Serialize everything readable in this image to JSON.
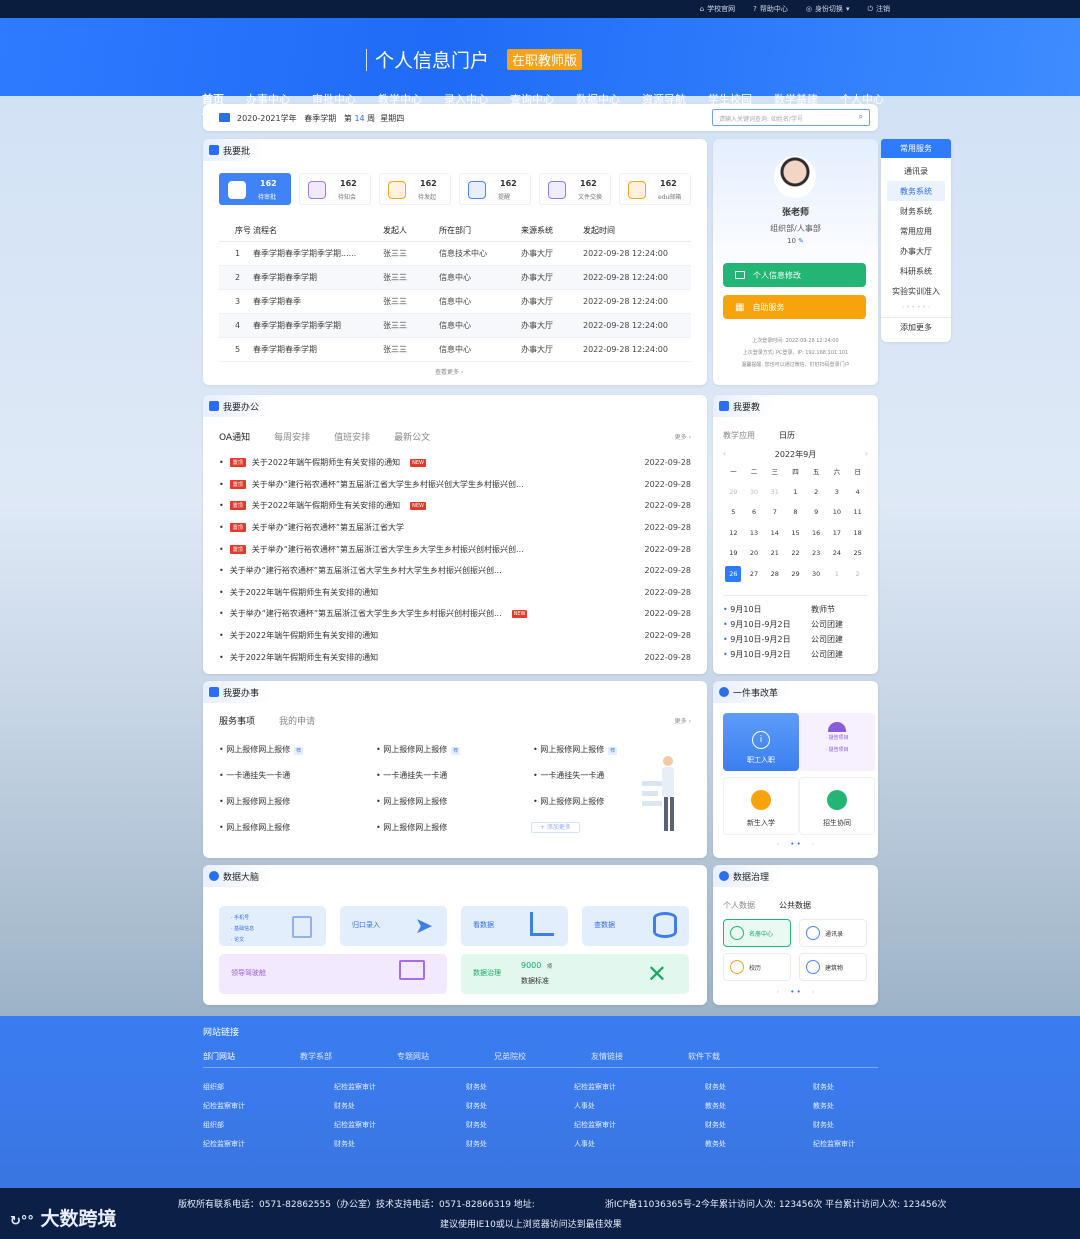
{
  "topbar": {
    "links": [
      "学校官网",
      "帮助中心",
      "身份切换",
      "注销"
    ]
  },
  "header": {
    "title": "个人信息门户",
    "edition": "在职教师版"
  },
  "nav": [
    "首页",
    "办事中心",
    "审批中心",
    "教学中心",
    "录入中心",
    "查询中心",
    "数据中心",
    "资源导航",
    "学生校园",
    "数学基建",
    "个人中心"
  ],
  "datebar": {
    "year": "2020-2021学年",
    "term": "春季学期",
    "week_pre": "第",
    "week": "14",
    "week_post": "周",
    "day": "星期四",
    "search_placeholder": "请输入关键词查询: 如姓名/学号"
  },
  "approve": {
    "title": "我要批",
    "stats": [
      {
        "n": "162",
        "l": "待审批",
        "color": "#ffffff"
      },
      {
        "n": "162",
        "l": "待知会",
        "color": "#f2e9ff"
      },
      {
        "n": "162",
        "l": "待发起",
        "color": "#fff3dd"
      },
      {
        "n": "162",
        "l": "提醒",
        "color": "#e8f0ff"
      },
      {
        "n": "162",
        "l": "文件交换",
        "color": "#f1ecff"
      },
      {
        "n": "162",
        "l": "edu邮箱",
        "color": "#fff1db"
      }
    ],
    "headers": [
      "序号",
      "流程名",
      "发起人",
      "所在部门",
      "来源系统",
      "发起时间"
    ],
    "rows": [
      [
        "1",
        "春季学期春季学期季学期......",
        "张三三",
        "信息技术中心",
        "办事大厅",
        "2022-09-28  12:24:00"
      ],
      [
        "2",
        "春季学期春季学期",
        "张三三",
        "信息中心",
        "办事大厅",
        "2022-09-28  12:24:00"
      ],
      [
        "3",
        "春季学期春季",
        "张三三",
        "信息中心",
        "办事大厅",
        "2022-09-28  12:24:00"
      ],
      [
        "4",
        "春季学期春季学期季学期",
        "张三三",
        "信息中心",
        "办事大厅",
        "2022-09-28  12:24:00"
      ],
      [
        "5",
        "春季学期春季学期",
        "张三三",
        "信息中心",
        "办事大厅",
        "2022-09-28  12:24:00"
      ]
    ],
    "more": "查看更多"
  },
  "profile": {
    "name": "张老师",
    "dept": "组织部/人事部",
    "score": "10",
    "btn_edit": "个人信息修改",
    "btn_self": "自助服务",
    "last_login": "上次登录时间: 2022-09-28  12:24:00",
    "login_way": "上次登录方式: PC登录，IP: 192.168.101.101",
    "tip": "温馨提醒: 您也可以通过微信、钉钉扫码登录门户"
  },
  "quick": {
    "title": "常用服务",
    "items": [
      "通讯录",
      "教务系统",
      "财务系统",
      "常用应用",
      "办事大厅",
      "科研系统",
      "实验实训准入"
    ],
    "add": "添加更多"
  },
  "office": {
    "title": "我要办公",
    "tabs": [
      "OA通知",
      "每周安排",
      "值班安排",
      "最新公文"
    ],
    "more": "更多",
    "top_tag": "置顶",
    "new_tag": "NEW",
    "items": [
      {
        "t": "关于2022年端午假期师生有关安排的通知",
        "d": "2022-09-28",
        "top": true,
        "new": true
      },
      {
        "t": "关于举办“建行裕农通杯”第五届浙江省大学生乡村振兴创大学生乡村振兴创...",
        "d": "2022-09-28",
        "top": true,
        "new": false
      },
      {
        "t": "关于2022年端午假期师生有关安排的通知",
        "d": "2022-09-28",
        "top": true,
        "new": true
      },
      {
        "t": "关于举办“建行裕农通杯”第五届浙江省大学",
        "d": "2022-09-28",
        "top": true,
        "new": false
      },
      {
        "t": "关于举办“建行裕农通杯”第五届浙江省大学生乡大学生乡村振兴创村振兴创...",
        "d": "2022-09-28",
        "top": true,
        "new": false
      },
      {
        "t": "关于举办“建行裕农通杯”第五届浙江省大学生乡村大学生乡村振兴创振兴创...",
        "d": "2022-09-28",
        "top": false,
        "new": false
      },
      {
        "t": "关于2022年端午假期师生有关安排的通知",
        "d": "2022-09-28",
        "top": false,
        "new": false
      },
      {
        "t": "关于举办“建行裕农通杯”第五届浙江省大学生乡大学生乡村振兴创村振兴创...",
        "d": "2022-09-28",
        "top": false,
        "new": true
      },
      {
        "t": "关于2022年端午假期师生有关安排的通知",
        "d": "2022-09-28",
        "top": false,
        "new": false
      },
      {
        "t": "关于2022年端午假期师生有关安排的通知",
        "d": "2022-09-28",
        "top": false,
        "new": false
      }
    ]
  },
  "teach": {
    "title": "我要教",
    "tabs": [
      "教学应用",
      "日历"
    ],
    "month": "2022年9月",
    "weekdays": [
      "一",
      "二",
      "三",
      "四",
      "五",
      "六",
      "日"
    ],
    "weeks": [
      [
        "29",
        "30",
        "31",
        "1",
        "2",
        "3",
        "4"
      ],
      [
        "5",
        "6",
        "7",
        "8",
        "9",
        "10",
        "11"
      ],
      [
        "12",
        "13",
        "14",
        "15",
        "16",
        "17",
        "18"
      ],
      [
        "19",
        "20",
        "21",
        "22",
        "23",
        "24",
        "25"
      ],
      [
        "26",
        "27",
        "28",
        "29",
        "30",
        "1",
        "2"
      ]
    ],
    "events": [
      [
        "9月10日",
        "教师节"
      ],
      [
        "9月10日-9月2日",
        "公司团建"
      ],
      [
        "9月10日-9月2日",
        "公司团建"
      ],
      [
        "9月10日-9月2日",
        "公司团建"
      ]
    ]
  },
  "svc": {
    "title": "我要办事",
    "tabs": [
      "服务事项",
      "我的申请"
    ],
    "more": "更多",
    "rows": [
      [
        "网上报修网上报修",
        "网上报修网上报修",
        "网上报修网上报修"
      ],
      [
        "一卡通挂失一卡通",
        "一卡通挂失一卡通",
        "一卡通挂失一卡通"
      ],
      [
        "网上报修网上报修",
        "网上报修网上报修",
        "网上报修网上报修"
      ],
      [
        "网上报修网上报修",
        "网上报修网上报修",
        ""
      ]
    ],
    "tag": "荐",
    "add": "+ 添加更多"
  },
  "reform": {
    "title": "一件事改革",
    "tiles": [
      "职工入职",
      "新生入学",
      "招生协同"
    ],
    "t2a": "· 疑告项目",
    "t2b": "· 疑告项目"
  },
  "brain": {
    "title": "数据大脑",
    "b1": [
      "· 手机号",
      "· 基础信息",
      "· 论文"
    ],
    "b2": "归口录入",
    "b3": "看数据",
    "b4": "查数据",
    "b5": "领导驾驶舱",
    "b6": "数据治理",
    "b6n": "9000",
    "b6u": "项",
    "b6s": "数据标准"
  },
  "gov": {
    "title": "数据治理",
    "tabs": [
      "个人数据",
      "公共数据"
    ],
    "items": [
      "名册中心",
      "通讯录",
      "校历",
      "建筑物"
    ]
  },
  "footer": {
    "title": "网站链接",
    "tabs": [
      "部门网站",
      "教学系部",
      "专题网站",
      "兄弟院校",
      "友情链接",
      "软件下载"
    ],
    "cols": [
      [
        "组织部",
        "纪检监察审计",
        "组织部",
        "纪检监察审计"
      ],
      [
        "纪检监察审计",
        "财务处",
        "纪检监察审计",
        "财务处"
      ],
      [
        "财务处",
        "财务处",
        "财务处",
        "财务处"
      ],
      [
        "纪检监察审计",
        "人事处",
        "纪检监察审计",
        "人事处"
      ],
      [
        "财务处",
        "教务处",
        "财务处",
        "教务处"
      ],
      [
        "财务处",
        "教务处",
        "财务处",
        "纪检监察审计"
      ]
    ]
  },
  "bottom": {
    "l1": "版权所有联系电话：0571-82862555（办公室）技术支持电话：0571-82866319 地址:",
    "l1b": "浙ICP备11036365号-2今年累计访问人次: 123456次  平台累计访问人次: 123456次",
    "l2": "建议使用IE10或以上浏览器访问达到最佳效果",
    "wm": "大数跨境"
  }
}
